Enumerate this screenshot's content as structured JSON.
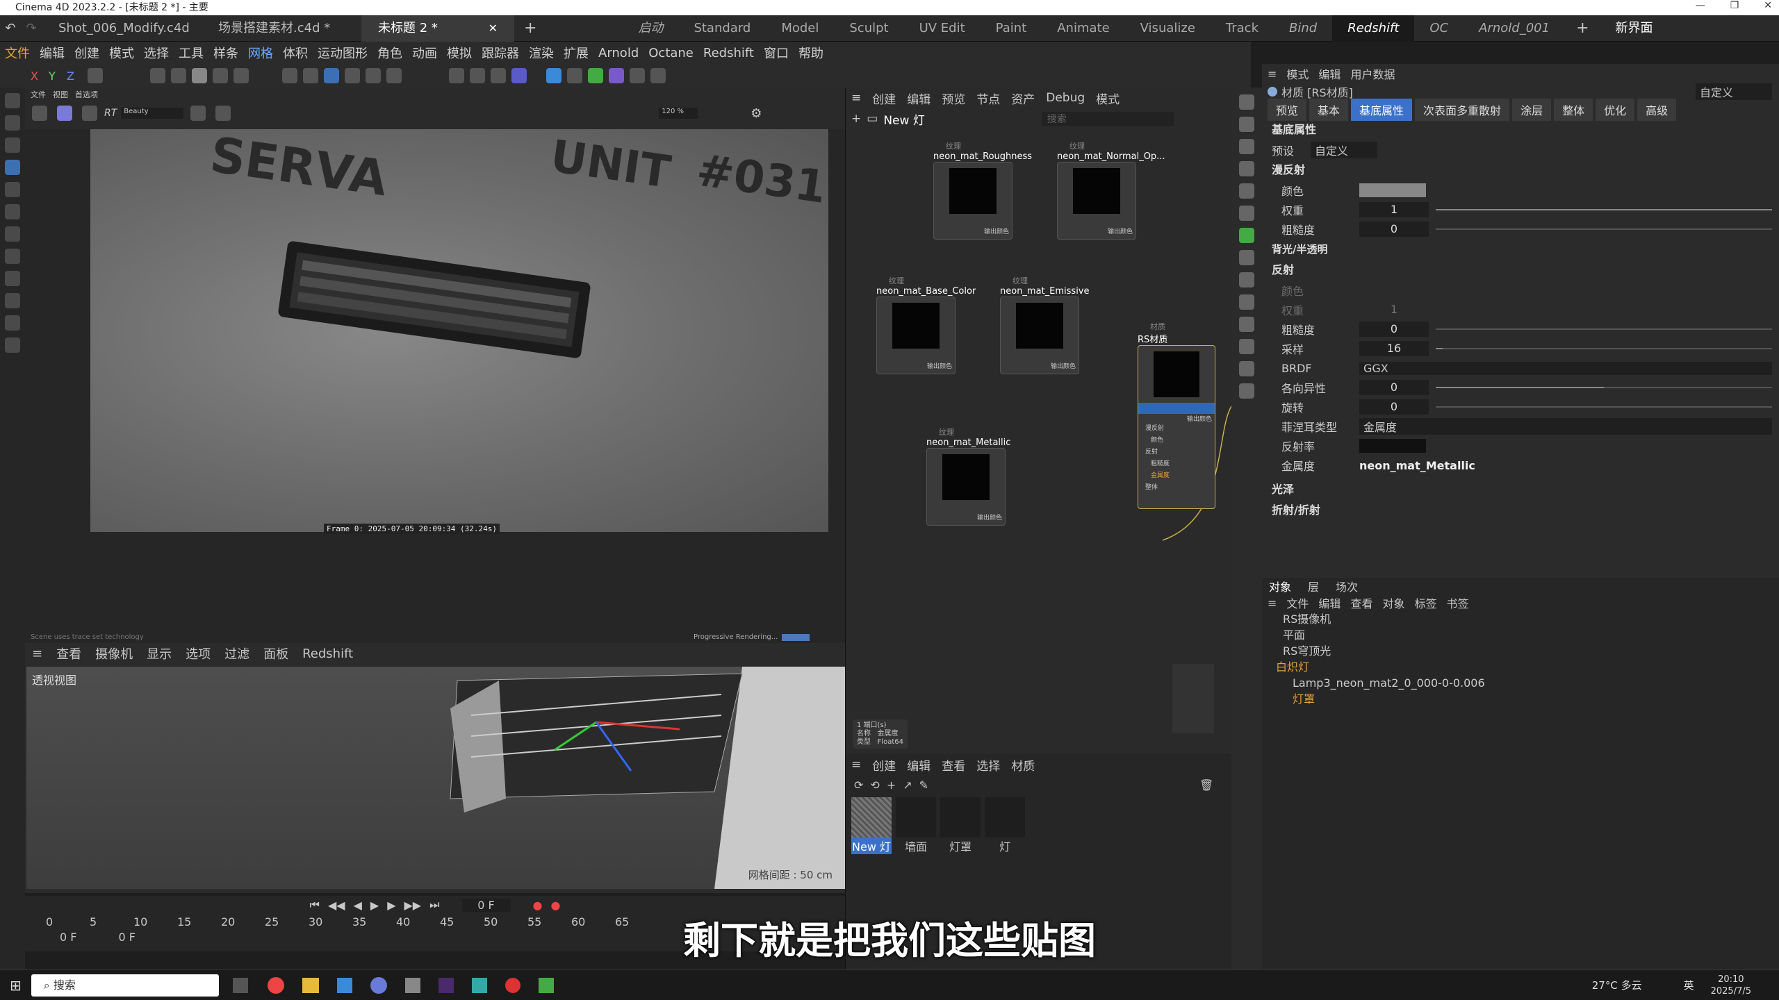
{
  "window": {
    "title": "Cinema 4D 2023.2.2 - [未标题 2 *] - 主要"
  },
  "doc_tabs": [
    "Shot_006_Modify.c4d",
    "场景搭建素材.c4d *",
    "未标题 2 *"
  ],
  "layouts": [
    "启动",
    "Standard",
    "Model",
    "Sculpt",
    "UV Edit",
    "Paint",
    "Animate",
    "Visualize",
    "Track",
    "Bind",
    "Redshift",
    "OC",
    "Arnold_001"
  ],
  "layout_right": "新界面",
  "menu": [
    "文件",
    "编辑",
    "创建",
    "模式",
    "选择",
    "工具",
    "样条",
    "网格",
    "体积",
    "运动图形",
    "角色",
    "动画",
    "模拟",
    "跟踪器",
    "渲染",
    "扩展",
    "Arnold",
    "Octane",
    "Redshift",
    "窗口",
    "帮助"
  ],
  "rv": {
    "menu": [
      "文件",
      "视图",
      "首选项"
    ],
    "beauty": "Beauty",
    "zoom": "120 %",
    "frame_info": "Frame  0:  2025-07-05  20:09:34  (32.24s)",
    "progress": "Progressive Rendering...",
    "status_left": "Scene uses trace set technology"
  },
  "vp": {
    "menu": [
      "查看",
      "摄像机",
      "显示",
      "选项",
      "过滤",
      "面板",
      "Redshift"
    ],
    "label": "透视视图",
    "grid": "网格间距 : 50 cm"
  },
  "timeline": {
    "ticks": [
      "0",
      "5",
      "10",
      "15",
      "20",
      "25",
      "30",
      "35",
      "40",
      "45",
      "50",
      "55",
      "60",
      "65"
    ],
    "frame": "0 F",
    "start": "0 F",
    "end": "0 F"
  },
  "ne": {
    "menu": [
      "创建",
      "编辑",
      "预览",
      "节点",
      "资产",
      "Debug",
      "模式"
    ],
    "breadcrumb": "New 灯",
    "search": "搜索",
    "nodes": {
      "rough": {
        "cat": "纹理",
        "title": "neon_mat_Roughness",
        "out": "输出颜色"
      },
      "normal": {
        "cat": "纹理",
        "title": "neon_mat_Normal_Op...",
        "out": "输出颜色"
      },
      "base": {
        "cat": "纹理",
        "title": "neon_mat_Base_Color",
        "out": "输出颜色"
      },
      "emis": {
        "cat": "纹理",
        "title": "neon_mat_Emissive",
        "out": "输出颜色"
      },
      "metal": {
        "cat": "纹理",
        "title": "neon_mat_Metallic",
        "out": "输出颜色"
      },
      "rsmat": {
        "cat": "材质",
        "title": "RS材质",
        "out": "输出颜色",
        "ports": [
          "漫反射",
          "颜色",
          "反射",
          "粗糙度",
          "金属度",
          "整体"
        ]
      }
    },
    "info": {
      "l1": "1 端口(s)",
      "k2": "名称",
      "v2": "金属度",
      "k3": "类型",
      "v3": "Float64"
    }
  },
  "mat": {
    "menu": [
      "创建",
      "编辑",
      "查看",
      "选择",
      "材质"
    ],
    "items": [
      "New 灯",
      "墙面",
      "灯罩",
      "灯"
    ]
  },
  "attr": {
    "menu": [
      "模式",
      "编辑",
      "用户数据"
    ],
    "header": "材质 [RS材质]",
    "header_right": "自定义",
    "tabs": [
      "预览",
      "基本",
      "基底属性",
      "次表面多重散射",
      "涂层",
      "整体",
      "优化",
      "高级"
    ],
    "section_title": "基底属性",
    "preset_label": "预设",
    "preset_value": "自定义",
    "diffuse": "漫反射",
    "backlight": "背光/半透明",
    "reflection": "反射",
    "sheen": "光泽",
    "refraction": "折射/折射",
    "diffuse_props": [
      {
        "label": "颜色",
        "value": ""
      },
      {
        "label": "权重",
        "value": "1"
      },
      {
        "label": "粗糙度",
        "value": "0"
      }
    ],
    "refl_props": [
      {
        "label": "颜色",
        "value": ""
      },
      {
        "label": "权重",
        "value": "1"
      },
      {
        "label": "粗糙度",
        "value": "0"
      },
      {
        "label": "采样",
        "value": "16"
      },
      {
        "label": "BRDF",
        "value": "GGX"
      },
      {
        "label": "各向异性",
        "value": "0"
      },
      {
        "label": "旋转",
        "value": "0"
      },
      {
        "label": "菲涅耳类型",
        "value": "金属度"
      },
      {
        "label": "反射率",
        "value": ""
      },
      {
        "label": "金属度",
        "value": "neon_mat_Metallic"
      }
    ]
  },
  "obj": {
    "tabs": [
      "对象",
      "层",
      "场次"
    ],
    "menu": [
      "文件",
      "编辑",
      "查看",
      "对象",
      "标签",
      "书签"
    ],
    "items": [
      "RS摄像机",
      "平面",
      "RS穹顶光",
      "白炽灯",
      "Lamp3_neon_mat2_0_000-0-0.006",
      "灯罩"
    ]
  },
  "subtitle": "剩下就是把我们这些贴图",
  "taskbar": {
    "search": "搜索",
    "weather": "27°C 多云",
    "lang": "英",
    "time": "20:10",
    "date": "2025/7/5"
  }
}
